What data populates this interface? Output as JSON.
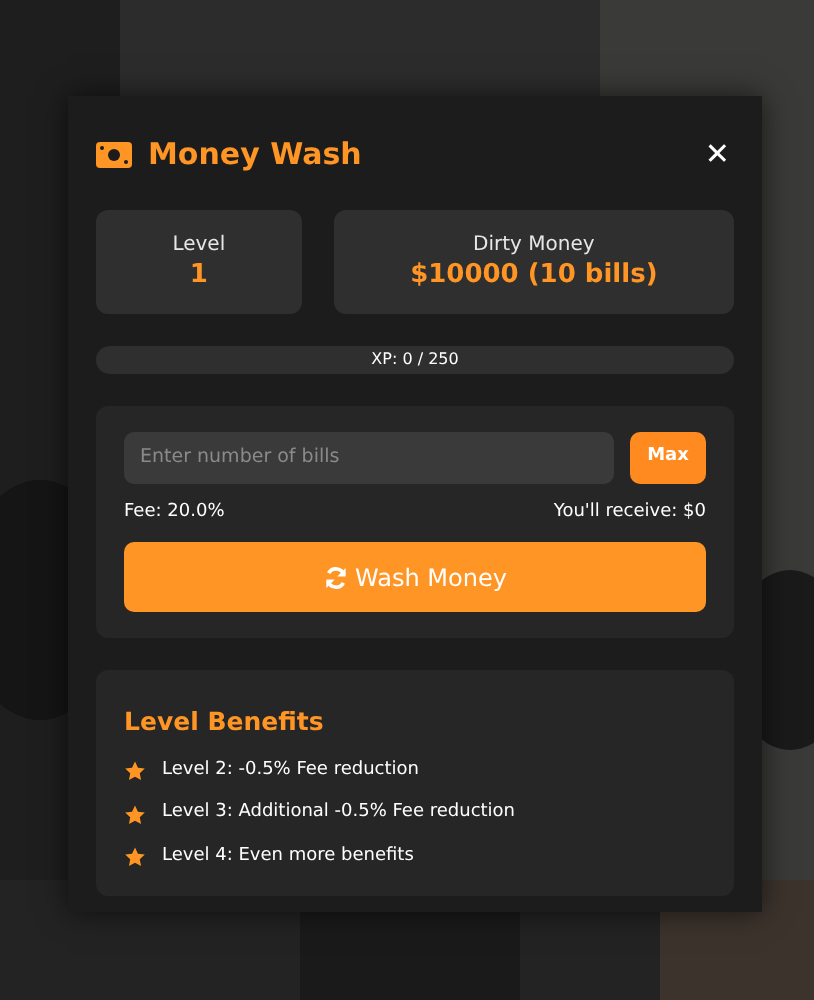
{
  "window": {
    "title": "Money Wash",
    "close": "✕"
  },
  "stats": [
    {
      "label": "Level",
      "value": "1"
    },
    {
      "label": "Dirty Money",
      "value": "$10000 (10 bills)"
    }
  ],
  "xp": {
    "text": "XP: 0 / 250",
    "level": 0
  },
  "wash": {
    "placeholder": "Enter number of bills",
    "max_button": "Max",
    "fee": "Fee: 20.0%",
    "receive": "You'll receive: $0",
    "button": "Wash Money"
  },
  "benefits": {
    "title": "Level Benefits",
    "items": [
      "Level 2: -0.5% Fee reduction",
      "Level 3: Additional -0.5% Fee reduction",
      "Level 4: Even more benefits"
    ]
  }
}
